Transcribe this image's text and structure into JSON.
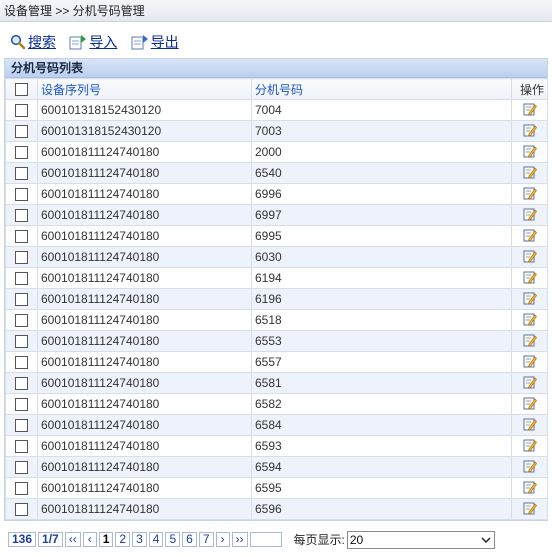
{
  "breadcrumb": "设备管理 >> 分机号码管理",
  "toolbar": {
    "search": "搜索",
    "import": "导入",
    "export": "导出"
  },
  "panel_title": "分机号码列表",
  "columns": {
    "serial": "设备序列号",
    "ext": "分机号码",
    "op": "操作"
  },
  "rows": [
    {
      "serial": "600101318152430120",
      "ext": "7004"
    },
    {
      "serial": "600101318152430120",
      "ext": "7003"
    },
    {
      "serial": "600101811124740180",
      "ext": "2000"
    },
    {
      "serial": "600101811124740180",
      "ext": "6540"
    },
    {
      "serial": "600101811124740180",
      "ext": "6996"
    },
    {
      "serial": "600101811124740180",
      "ext": "6997"
    },
    {
      "serial": "600101811124740180",
      "ext": "6995"
    },
    {
      "serial": "600101811124740180",
      "ext": "6030"
    },
    {
      "serial": "600101811124740180",
      "ext": "6194"
    },
    {
      "serial": "600101811124740180",
      "ext": "6196"
    },
    {
      "serial": "600101811124740180",
      "ext": "6518"
    },
    {
      "serial": "600101811124740180",
      "ext": "6553"
    },
    {
      "serial": "600101811124740180",
      "ext": "6557"
    },
    {
      "serial": "600101811124740180",
      "ext": "6581"
    },
    {
      "serial": "600101811124740180",
      "ext": "6582"
    },
    {
      "serial": "600101811124740180",
      "ext": "6584"
    },
    {
      "serial": "600101811124740180",
      "ext": "6593"
    },
    {
      "serial": "600101811124740180",
      "ext": "6594"
    },
    {
      "serial": "600101811124740180",
      "ext": "6595"
    },
    {
      "serial": "600101811124740180",
      "ext": "6596"
    }
  ],
  "pager": {
    "total": "136",
    "page_info": "1/7",
    "first": "‹‹",
    "prev": "‹",
    "pages": [
      "1",
      "2",
      "3",
      "4",
      "5",
      "6",
      "7"
    ],
    "current": "1",
    "next": "›",
    "last": "››",
    "per_page_label": "每页显示:",
    "per_page_value": "20"
  },
  "icons": {
    "search": "magnifier-icon",
    "import": "import-icon",
    "export": "export-icon",
    "edit": "edit-icon"
  }
}
